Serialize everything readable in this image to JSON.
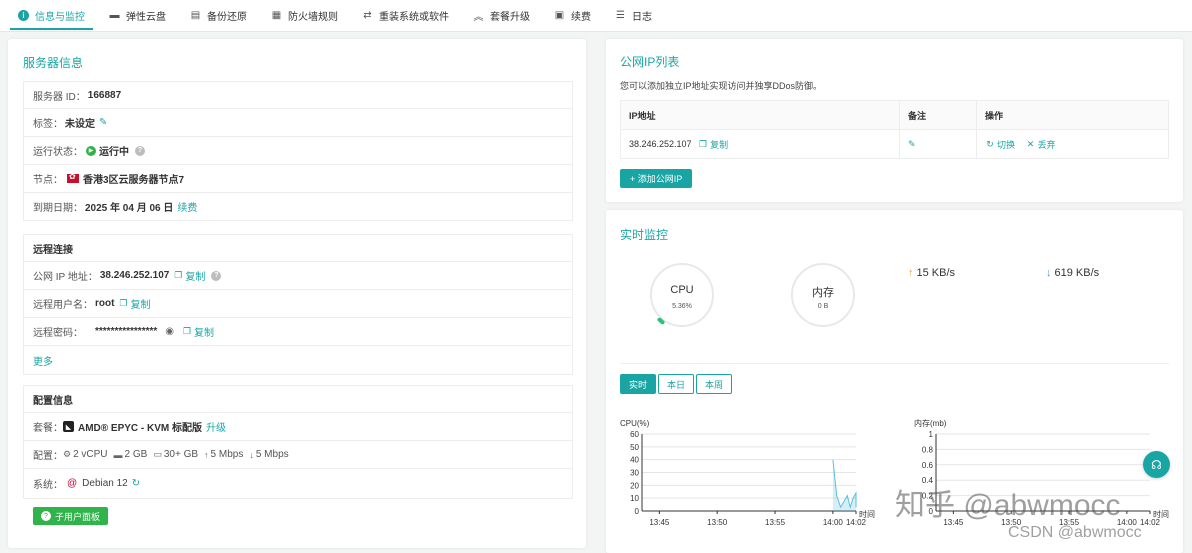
{
  "tabs": [
    {
      "label": "信息与监控",
      "icon": "info-icon",
      "active": true
    },
    {
      "label": "弹性云盘",
      "icon": "disk-icon"
    },
    {
      "label": "备份还原",
      "icon": "backup-icon"
    },
    {
      "label": "防火墙规则",
      "icon": "firewall-icon"
    },
    {
      "label": "重装系统或软件",
      "icon": "swap-icon"
    },
    {
      "label": "套餐升级",
      "icon": "upgrade-icon"
    },
    {
      "label": "续费",
      "icon": "renew-icon"
    },
    {
      "label": "日志",
      "icon": "log-icon"
    }
  ],
  "server": {
    "title": "服务器信息",
    "id_label": "服务器 ID：",
    "id_value": "166887",
    "tag_label": "标签：",
    "tag_value": "未设定",
    "status_label": "运行状态：",
    "status_value": "运行中",
    "node_label": "节点：",
    "node_value": "香港3区云服务器节点7",
    "expire_label": "到期日期：",
    "expire_value": "2025 年 04 月 06 日",
    "renew_link": "续费"
  },
  "remote": {
    "title": "远程连接",
    "ip_label": "公网 IP 地址：",
    "ip_value": "38.246.252.107",
    "user_label": "远程用户名：",
    "user_value": "root",
    "pwd_label": "远程密码：",
    "pwd_value": "****************",
    "copy_label": "复制",
    "more_link": "更多"
  },
  "config": {
    "title": "配置信息",
    "plan_label": "套餐：",
    "plan_value": "AMD® EPYC - KVM 标配版",
    "upgrade_link": "升级",
    "spec_label": "配置：",
    "cpu": "2 vCPU",
    "ram": "2 GB",
    "disk": "30+ GB",
    "up_bw": "5 Mbps",
    "down_bw": "5 Mbps",
    "os_label": "系统：",
    "os_value": "Debian 12",
    "panel_button": "子用户面板"
  },
  "ip_list": {
    "title": "公网IP列表",
    "desc": "您可以添加独立IP地址实现访问并独享DDos防御。",
    "headers": [
      "IP地址",
      "备注",
      "操作"
    ],
    "rows": [
      {
        "ip": "38.246.252.107",
        "copy": "复制",
        "switch": "切换",
        "discard": "丢弃"
      }
    ],
    "add_button": "+ 添加公网IP"
  },
  "monitor": {
    "title": "实时监控",
    "cpu_label": "CPU",
    "cpu_value": "5.36%",
    "mem_label": "内存",
    "mem_value": "0 B",
    "up_speed": "15 KB/s",
    "down_speed": "619 KB/s",
    "range_tabs": [
      "实时",
      "本日",
      "本周"
    ]
  },
  "chart_data": [
    {
      "type": "line",
      "title": "CPU(%)",
      "xlabel": "时间",
      "ylabel": "CPU(%)",
      "ylim": [
        0,
        60
      ],
      "yticks": [
        0,
        10,
        20,
        30,
        40,
        50,
        60
      ],
      "xticks": [
        "13:45",
        "13:50",
        "13:55",
        "14:00",
        "14:02"
      ],
      "x": [
        "14:00",
        "14:00",
        "14:00",
        "14:01",
        "14:01",
        "14:01",
        "14:01",
        "14:02",
        "14:02"
      ],
      "values": [
        40,
        12,
        3,
        8,
        12,
        3,
        10,
        14,
        3
      ],
      "color": "#5bc0de"
    },
    {
      "type": "line",
      "title": "内存(mb)",
      "xlabel": "时间",
      "ylabel": "内存(mb)",
      "ylim": [
        0,
        1
      ],
      "yticks": [
        0,
        0.2,
        0.4,
        0.6,
        0.8,
        1
      ],
      "xticks": [
        "13:45",
        "13:50",
        "13:55",
        "14:00",
        "14:02"
      ],
      "values": []
    }
  ],
  "watermark": {
    "zhihu": "知乎 @abwmocc",
    "csdn": "CSDN @abwmocc"
  }
}
